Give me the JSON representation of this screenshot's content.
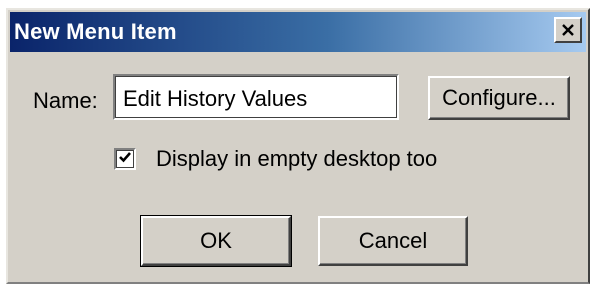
{
  "window": {
    "title": "New Menu Item"
  },
  "form": {
    "name_label": "Name:",
    "name_value": "Edit History Values",
    "configure_label": "Configure...",
    "checkbox_label": "Display in empty desktop too",
    "checkbox_checked": true
  },
  "buttons": {
    "ok_label": "OK",
    "cancel_label": "Cancel"
  },
  "icons": {
    "close": "close-icon",
    "check": "checkmark-icon"
  },
  "colors": {
    "title_start": "#0a246a",
    "title_end": "#a6caf0",
    "face": "#d4d0c8"
  }
}
